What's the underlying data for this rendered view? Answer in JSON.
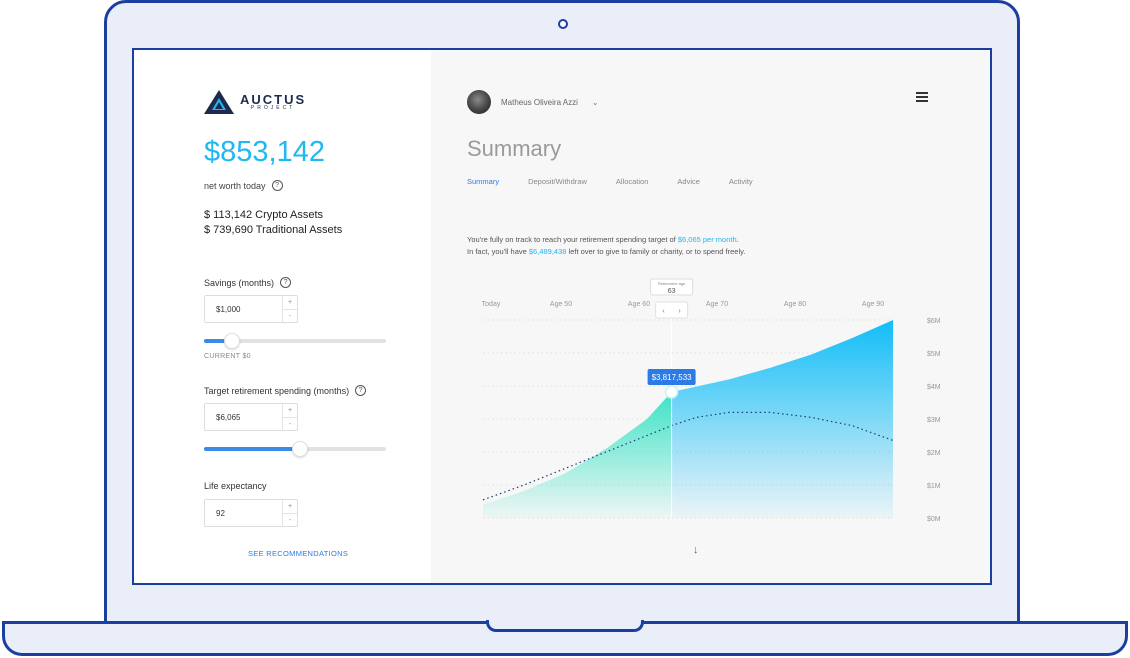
{
  "brand": {
    "name": "AUCTUS",
    "sub": "PROJECT"
  },
  "net_worth": {
    "value": "$853,142",
    "label": "net worth today"
  },
  "assets": [
    "$ 113,142 Crypto Assets",
    "$ 739,690 Traditional Assets"
  ],
  "savings": {
    "label": "Savings (months)",
    "value": "$1,000",
    "current": "CURRENT $0",
    "slider_level": 0.15
  },
  "target": {
    "label": "Target retirement spending (months)",
    "value": "$6,065",
    "slider_level": 0.52
  },
  "life": {
    "label": "Life expectancy",
    "value": "92"
  },
  "see_recommendations": "SEE RECOMMENDATIONS",
  "user": {
    "name": "Matheus Oliveira Azzi"
  },
  "page_title": "Summary",
  "tabs": [
    {
      "label": "Summary",
      "active": true
    },
    {
      "label": "Deposit/Withdraw",
      "active": false
    },
    {
      "label": "Allocation",
      "active": false
    },
    {
      "label": "Advice",
      "active": false
    },
    {
      "label": "Activity",
      "active": false
    }
  ],
  "message": {
    "line1_pre": "You're fully on track to reach your retirement spending target of ",
    "line1_hl": "$6,065 per month",
    "line1_post": ".",
    "line2_pre": "In fact, you'll have ",
    "line2_hl": "$6,489,438",
    "line2_post": " left over to give to family or charity, or to spend freely."
  },
  "icons": {
    "help": "question-circle-icon",
    "menu": "hamburger-menu-icon",
    "arrow": "down-arrow-icon"
  },
  "colors": {
    "accent": "#1fb8f2",
    "link": "#2a7be4",
    "frame": "#1a3fa0",
    "teal": "#3de3c6"
  },
  "chart_data": {
    "type": "area",
    "x_ticks": [
      "Today",
      "Age 50",
      "Age 60",
      "Age 70",
      "Age 80",
      "Age 90"
    ],
    "y_ticks": [
      "$0M",
      "$1M",
      "$2M",
      "$3M",
      "$4M",
      "$5M",
      "$6M"
    ],
    "ylim": [
      0,
      6
    ],
    "retirement_age_label": "Retirement age",
    "retirement_age": 63,
    "retirement_value_label": "$3,817,533",
    "series": [
      {
        "name": "",
        "points": [
          [
            40,
            0.4
          ],
          [
            45,
            0.82
          ],
          [
            50,
            1.35
          ],
          [
            55,
            2.1
          ],
          [
            60,
            3.0
          ],
          [
            63,
            3.82
          ],
          [
            70,
            4.2
          ],
          [
            75,
            4.55
          ],
          [
            80,
            4.95
          ],
          [
            85,
            5.45
          ],
          [
            90,
            6.0
          ]
        ]
      },
      {
        "name": "",
        "style": "dotted",
        "points": [
          [
            40,
            0.55
          ],
          [
            45,
            1.0
          ],
          [
            50,
            1.5
          ],
          [
            55,
            2.0
          ],
          [
            60,
            2.5
          ],
          [
            63,
            2.8
          ],
          [
            66,
            3.05
          ],
          [
            70,
            3.2
          ],
          [
            75,
            3.2
          ],
          [
            80,
            3.05
          ],
          [
            85,
            2.8
          ],
          [
            90,
            2.35
          ]
        ]
      }
    ]
  }
}
